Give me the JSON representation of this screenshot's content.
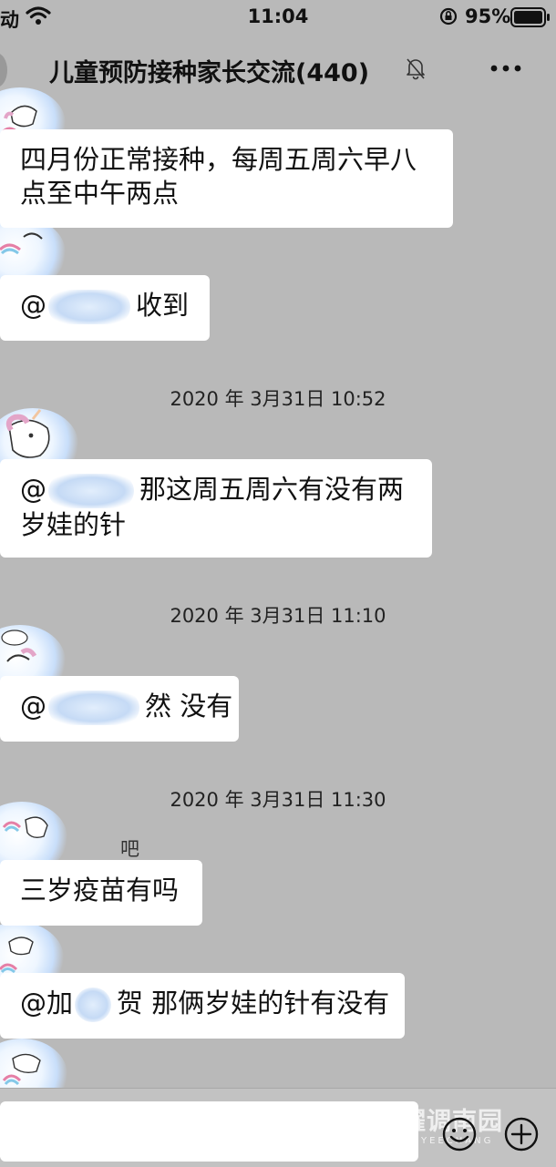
{
  "status_bar": {
    "carrier_fragment": "动",
    "time": "11:04",
    "battery": "95%"
  },
  "header": {
    "title": "儿童预防接种家长交流(440)"
  },
  "messages": [
    {
      "lines": [
        "四月份正常接种，每周五周六早八",
        "点至中午两点"
      ]
    },
    {
      "prefix": "@",
      "text": "收到"
    },
    {
      "timestamp": "2020 年 3月31日 10:52"
    },
    {
      "prefix": "@",
      "lines": [
        "那这周五周六有没有两",
        "岁娃的针"
      ]
    },
    {
      "timestamp": "2020 年 3月31日 11:10"
    },
    {
      "prefix": "@",
      "text": "然 没有"
    },
    {
      "timestamp": "2020 年 3月31日 11:30"
    },
    {
      "sender_fragment": "吧",
      "text": "三岁疫苗有吗"
    },
    {
      "prefix": "@加",
      "text": "贺 那俩岁娃的针有没有"
    }
  ],
  "watermark": {
    "text": "耀调南园",
    "sub": "YEECHANG"
  },
  "colors": {
    "background": "#b9b9b9",
    "bubble": "#ffffff",
    "input_bar": "#c2c2c2"
  },
  "icons": [
    "wifi-icon",
    "rotation-lock-icon",
    "battery-icon",
    "mute-bell-icon",
    "more-icon",
    "emoji-icon",
    "add-icon"
  ]
}
